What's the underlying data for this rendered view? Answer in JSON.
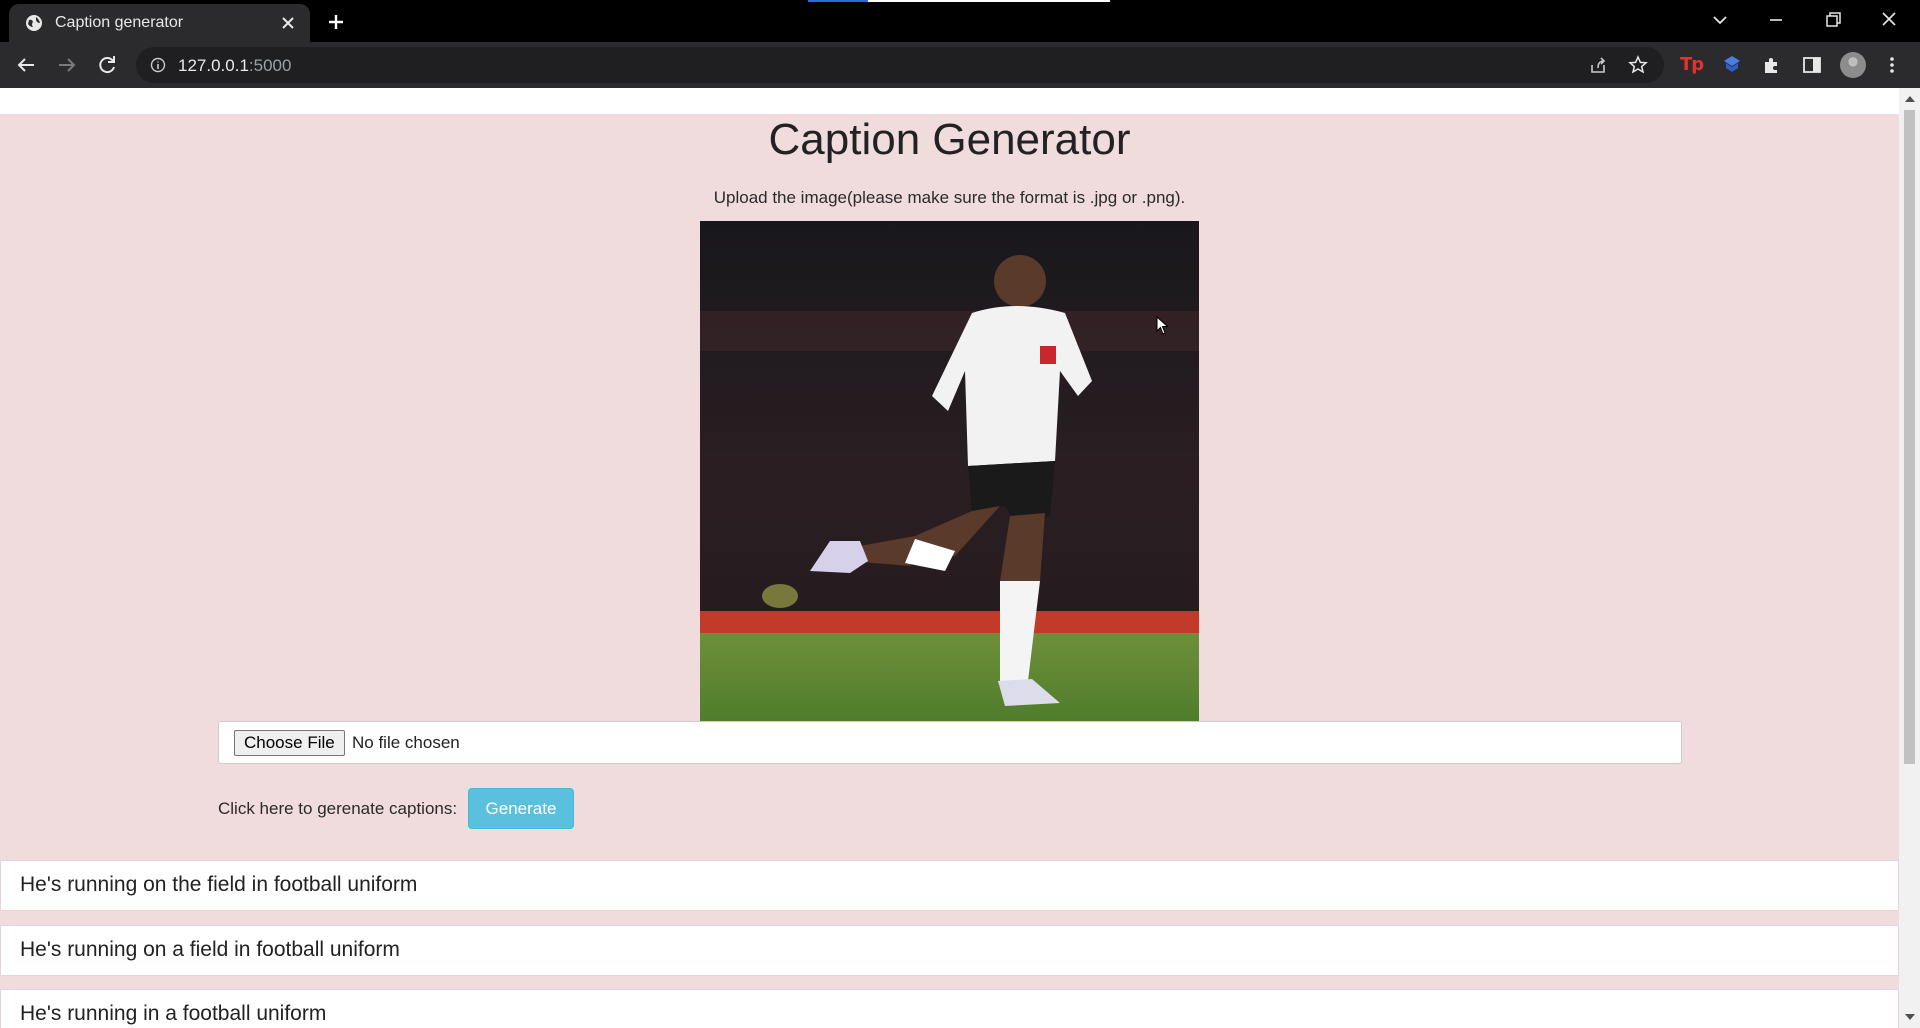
{
  "browser": {
    "tab_title": "Caption generator",
    "url_host": "127.0.0.1",
    "url_port": ":5000"
  },
  "page": {
    "title": "Caption Generator",
    "instructions": "Upload the image(please make sure the format is .jpg or .png).",
    "file_input": {
      "button_label": "Choose File",
      "status": "No file chosen"
    },
    "generate_label": "Click here to gerenate captions:",
    "generate_button": "Generate",
    "captions": [
      "He's running on the field in football uniform",
      "He's running on a field in football uniform",
      "He's running in a football uniform"
    ]
  },
  "colors": {
    "page_background": "#f0dcdd",
    "generate_button": "#5bc0de",
    "browser_frame": "#000000",
    "toolbar": "#2b2b2e"
  }
}
